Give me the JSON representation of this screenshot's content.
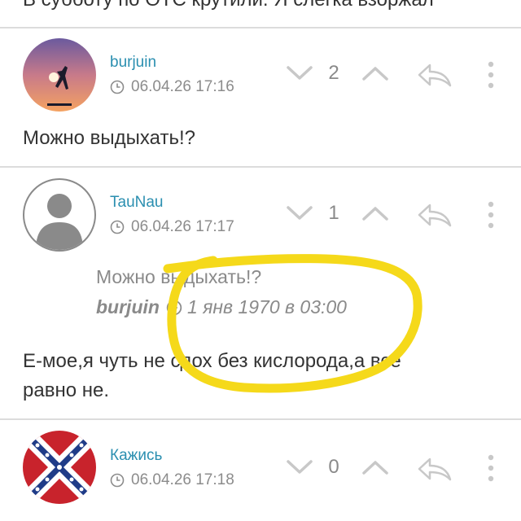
{
  "top_fragment": "В субботу по ОТС крутили. Я слегка взоржал",
  "comments": [
    {
      "username": "burjuin",
      "date": "06.04.26 17:16",
      "score": "2",
      "text": "Можно выдыхать!?",
      "avatar": "sunset-silhouette-avatar"
    },
    {
      "username": "TauNau",
      "date": "06.04.26 17:17",
      "score": "1",
      "quote": {
        "text": "Можно выдыхать!?",
        "author": "burjuin",
        "date": "1 янв 1970 в 03:00"
      },
      "text_line1": "Е-мое,я чуть не сдох без кислорода,а все",
      "text_line2": "равно не.",
      "avatar": "default-user-avatar"
    },
    {
      "username": "Кажись",
      "date": "06.04.26 17:18",
      "score": "0",
      "avatar": "confederate-flag-avatar"
    }
  ],
  "colors": {
    "username": "#2b8fb0",
    "meta": "#8c8c8c",
    "icon": "#c8c8c8",
    "highlight": "#f5d91a"
  }
}
